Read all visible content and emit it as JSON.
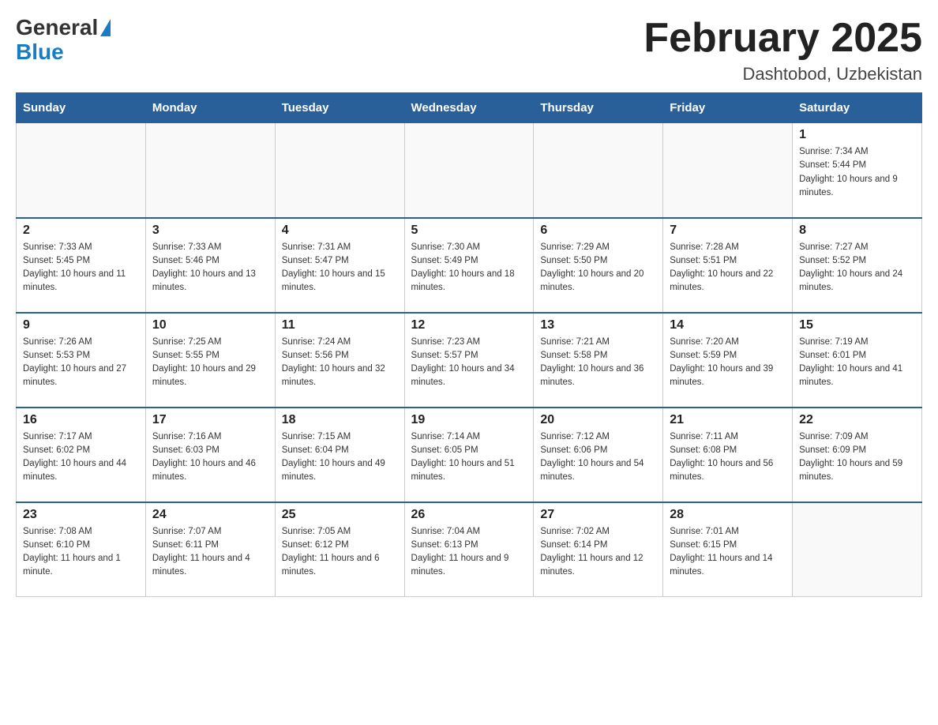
{
  "header": {
    "logo_general": "General",
    "logo_blue": "Blue",
    "month_title": "February 2025",
    "location": "Dashtobod, Uzbekistan"
  },
  "weekdays": [
    "Sunday",
    "Monday",
    "Tuesday",
    "Wednesday",
    "Thursday",
    "Friday",
    "Saturday"
  ],
  "weeks": [
    [
      {
        "day": "",
        "sunrise": "",
        "sunset": "",
        "daylight": ""
      },
      {
        "day": "",
        "sunrise": "",
        "sunset": "",
        "daylight": ""
      },
      {
        "day": "",
        "sunrise": "",
        "sunset": "",
        "daylight": ""
      },
      {
        "day": "",
        "sunrise": "",
        "sunset": "",
        "daylight": ""
      },
      {
        "day": "",
        "sunrise": "",
        "sunset": "",
        "daylight": ""
      },
      {
        "day": "",
        "sunrise": "",
        "sunset": "",
        "daylight": ""
      },
      {
        "day": "1",
        "sunrise": "Sunrise: 7:34 AM",
        "sunset": "Sunset: 5:44 PM",
        "daylight": "Daylight: 10 hours and 9 minutes."
      }
    ],
    [
      {
        "day": "2",
        "sunrise": "Sunrise: 7:33 AM",
        "sunset": "Sunset: 5:45 PM",
        "daylight": "Daylight: 10 hours and 11 minutes."
      },
      {
        "day": "3",
        "sunrise": "Sunrise: 7:33 AM",
        "sunset": "Sunset: 5:46 PM",
        "daylight": "Daylight: 10 hours and 13 minutes."
      },
      {
        "day": "4",
        "sunrise": "Sunrise: 7:31 AM",
        "sunset": "Sunset: 5:47 PM",
        "daylight": "Daylight: 10 hours and 15 minutes."
      },
      {
        "day": "5",
        "sunrise": "Sunrise: 7:30 AM",
        "sunset": "Sunset: 5:49 PM",
        "daylight": "Daylight: 10 hours and 18 minutes."
      },
      {
        "day": "6",
        "sunrise": "Sunrise: 7:29 AM",
        "sunset": "Sunset: 5:50 PM",
        "daylight": "Daylight: 10 hours and 20 minutes."
      },
      {
        "day": "7",
        "sunrise": "Sunrise: 7:28 AM",
        "sunset": "Sunset: 5:51 PM",
        "daylight": "Daylight: 10 hours and 22 minutes."
      },
      {
        "day": "8",
        "sunrise": "Sunrise: 7:27 AM",
        "sunset": "Sunset: 5:52 PM",
        "daylight": "Daylight: 10 hours and 24 minutes."
      }
    ],
    [
      {
        "day": "9",
        "sunrise": "Sunrise: 7:26 AM",
        "sunset": "Sunset: 5:53 PM",
        "daylight": "Daylight: 10 hours and 27 minutes."
      },
      {
        "day": "10",
        "sunrise": "Sunrise: 7:25 AM",
        "sunset": "Sunset: 5:55 PM",
        "daylight": "Daylight: 10 hours and 29 minutes."
      },
      {
        "day": "11",
        "sunrise": "Sunrise: 7:24 AM",
        "sunset": "Sunset: 5:56 PM",
        "daylight": "Daylight: 10 hours and 32 minutes."
      },
      {
        "day": "12",
        "sunrise": "Sunrise: 7:23 AM",
        "sunset": "Sunset: 5:57 PM",
        "daylight": "Daylight: 10 hours and 34 minutes."
      },
      {
        "day": "13",
        "sunrise": "Sunrise: 7:21 AM",
        "sunset": "Sunset: 5:58 PM",
        "daylight": "Daylight: 10 hours and 36 minutes."
      },
      {
        "day": "14",
        "sunrise": "Sunrise: 7:20 AM",
        "sunset": "Sunset: 5:59 PM",
        "daylight": "Daylight: 10 hours and 39 minutes."
      },
      {
        "day": "15",
        "sunrise": "Sunrise: 7:19 AM",
        "sunset": "Sunset: 6:01 PM",
        "daylight": "Daylight: 10 hours and 41 minutes."
      }
    ],
    [
      {
        "day": "16",
        "sunrise": "Sunrise: 7:17 AM",
        "sunset": "Sunset: 6:02 PM",
        "daylight": "Daylight: 10 hours and 44 minutes."
      },
      {
        "day": "17",
        "sunrise": "Sunrise: 7:16 AM",
        "sunset": "Sunset: 6:03 PM",
        "daylight": "Daylight: 10 hours and 46 minutes."
      },
      {
        "day": "18",
        "sunrise": "Sunrise: 7:15 AM",
        "sunset": "Sunset: 6:04 PM",
        "daylight": "Daylight: 10 hours and 49 minutes."
      },
      {
        "day": "19",
        "sunrise": "Sunrise: 7:14 AM",
        "sunset": "Sunset: 6:05 PM",
        "daylight": "Daylight: 10 hours and 51 minutes."
      },
      {
        "day": "20",
        "sunrise": "Sunrise: 7:12 AM",
        "sunset": "Sunset: 6:06 PM",
        "daylight": "Daylight: 10 hours and 54 minutes."
      },
      {
        "day": "21",
        "sunrise": "Sunrise: 7:11 AM",
        "sunset": "Sunset: 6:08 PM",
        "daylight": "Daylight: 10 hours and 56 minutes."
      },
      {
        "day": "22",
        "sunrise": "Sunrise: 7:09 AM",
        "sunset": "Sunset: 6:09 PM",
        "daylight": "Daylight: 10 hours and 59 minutes."
      }
    ],
    [
      {
        "day": "23",
        "sunrise": "Sunrise: 7:08 AM",
        "sunset": "Sunset: 6:10 PM",
        "daylight": "Daylight: 11 hours and 1 minute."
      },
      {
        "day": "24",
        "sunrise": "Sunrise: 7:07 AM",
        "sunset": "Sunset: 6:11 PM",
        "daylight": "Daylight: 11 hours and 4 minutes."
      },
      {
        "day": "25",
        "sunrise": "Sunrise: 7:05 AM",
        "sunset": "Sunset: 6:12 PM",
        "daylight": "Daylight: 11 hours and 6 minutes."
      },
      {
        "day": "26",
        "sunrise": "Sunrise: 7:04 AM",
        "sunset": "Sunset: 6:13 PM",
        "daylight": "Daylight: 11 hours and 9 minutes."
      },
      {
        "day": "27",
        "sunrise": "Sunrise: 7:02 AM",
        "sunset": "Sunset: 6:14 PM",
        "daylight": "Daylight: 11 hours and 12 minutes."
      },
      {
        "day": "28",
        "sunrise": "Sunrise: 7:01 AM",
        "sunset": "Sunset: 6:15 PM",
        "daylight": "Daylight: 11 hours and 14 minutes."
      },
      {
        "day": "",
        "sunrise": "",
        "sunset": "",
        "daylight": ""
      }
    ]
  ]
}
